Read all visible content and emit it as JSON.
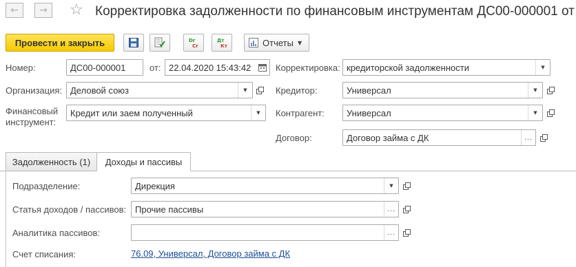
{
  "window": {
    "title": "Корректировка задолженности по финансовым инструментам ДС00-000001 от"
  },
  "toolbar": {
    "post_close_label": "Провести и закрыть",
    "reports_label": "Отчеты"
  },
  "header": {
    "number_label": "Номер:",
    "number_value": "ДС00-000001",
    "date_label": "от:",
    "date_value": "22.04.2020 15:43:42",
    "organization_label": "Организация:",
    "organization_value": "Деловой союз",
    "instrument_label_line1": "Финансовый",
    "instrument_label_line2": "инструмент:",
    "instrument_value": "Кредит или заем полученный",
    "correction_label": "Корректировка:",
    "correction_value": "кредиторской задолженности",
    "creditor_label": "Кредитор:",
    "creditor_value": "Универсал",
    "counterparty_label": "Контрагент:",
    "counterparty_value": "Универсал",
    "contract_label": "Договор:",
    "contract_value": "Договор займа с ДК"
  },
  "tabs": [
    {
      "label": "Задолженность (1)",
      "active": false
    },
    {
      "label": "Доходы и пассивы",
      "active": true
    }
  ],
  "income_tab": {
    "department_label": "Подразделение:",
    "department_value": "Дирекция",
    "income_item_label": "Статья доходов / пассивов:",
    "income_item_value": "Прочие пассивы",
    "analytics_label": "Аналитика пассивов:",
    "analytics_value": "",
    "writeoff_label": "Счет списания:",
    "writeoff_value": "76.09, Универсал, Договор займа с ДК"
  },
  "icons": {
    "back": "arrow-left-icon",
    "forward": "arrow-right-icon",
    "favorite": "star-icon",
    "save": "floppy-disk-icon",
    "post": "post-document-icon",
    "dr_cr": "dr-cr-movements-icon",
    "dt_kt": "dt-kt-movements-icon",
    "reports": "reports-icon",
    "calendar": "calendar-icon",
    "open": "open-form-icon"
  },
  "colors": {
    "primary_button": "#f5cb00",
    "link": "#1a4f96"
  }
}
